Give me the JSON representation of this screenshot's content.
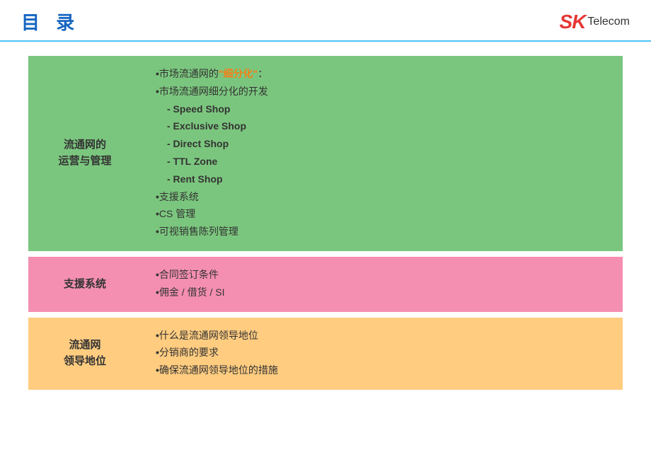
{
  "header": {
    "title": "目  录",
    "logo_sk": "SK",
    "logo_telecom": "Telecom"
  },
  "rows": [
    {
      "id": "row-green",
      "type": "green",
      "left_label_line1": "流通网的",
      "left_label_line2": "运营与管理",
      "content": [
        {
          "bullet": "•",
          "text_normal": "市场流通网的",
          "text_highlight": "\"细分化\"",
          "text_after": "：",
          "indent": 0
        },
        {
          "bullet": "•",
          "text_normal": "市场流通网细分化的开发",
          "text_highlight": "",
          "text_after": "",
          "indent": 0
        },
        {
          "bullet": "-",
          "text_normal": " Speed Shop",
          "text_highlight": "",
          "text_after": "",
          "indent": 1
        },
        {
          "bullet": "-",
          "text_normal": " Exclusive Shop",
          "text_highlight": "",
          "text_after": "",
          "indent": 1
        },
        {
          "bullet": "-",
          "text_normal": " Direct Shop",
          "text_highlight": "",
          "text_after": "",
          "indent": 1
        },
        {
          "bullet": "-",
          "text_normal": " TTL Zone",
          "text_highlight": "",
          "text_after": "",
          "indent": 1
        },
        {
          "bullet": "-",
          "text_normal": "  Rent Shop",
          "text_highlight": "",
          "text_after": "",
          "indent": 1
        },
        {
          "bullet": "•",
          "text_normal": "支援系统",
          "text_highlight": "",
          "text_after": "",
          "indent": 0
        },
        {
          "bullet": "•",
          "text_normal": "CS 管理",
          "text_highlight": "",
          "text_after": "",
          "indent": 0
        },
        {
          "bullet": "•",
          "text_normal": "可视销售陈列管理",
          "text_highlight": "",
          "text_after": "",
          "indent": 0
        }
      ]
    },
    {
      "id": "row-pink",
      "type": "pink",
      "left_label_line1": "支援系统",
      "left_label_line2": "",
      "content": [
        {
          "bullet": "•",
          "text_normal": "合同签订条件",
          "text_highlight": "",
          "text_after": "",
          "indent": 0
        },
        {
          "bullet": "•",
          "text_normal": "佣金 / 借货 / SI",
          "text_highlight": "",
          "text_after": "",
          "indent": 0
        }
      ]
    },
    {
      "id": "row-orange",
      "type": "orange",
      "left_label_line1": "流通网",
      "left_label_line2": "领导地位",
      "content": [
        {
          "bullet": "•",
          "text_normal": "什么是流通网领导地位",
          "text_highlight": "",
          "text_after": "",
          "indent": 0
        },
        {
          "bullet": "•",
          "text_normal": "分销商的要求",
          "text_highlight": "",
          "text_after": "",
          "indent": 0
        },
        {
          "bullet": "•",
          "text_normal": "确保流通网领导地位的措施",
          "text_highlight": "",
          "text_after": "",
          "indent": 0
        }
      ]
    }
  ]
}
